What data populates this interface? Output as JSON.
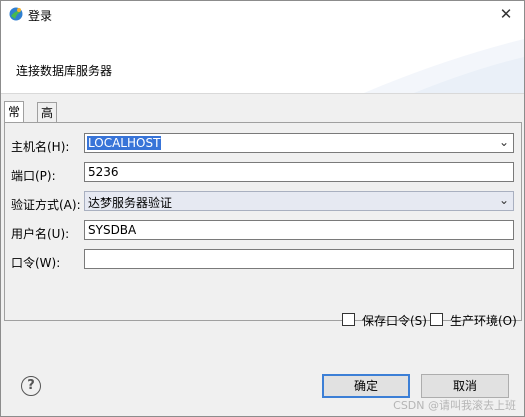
{
  "window": {
    "title": "登录",
    "close_symbol": "✕",
    "banner_text": "连接数据库服务器"
  },
  "tabs": [
    {
      "label": "常规",
      "active": true
    },
    {
      "label": "高级",
      "active": false
    }
  ],
  "form": {
    "host_label": "主机名(H):",
    "host_value": "LOCALHOST",
    "port_label": "端口(P):",
    "port_value": "5236",
    "auth_label": "验证方式(A):",
    "auth_value": "达梦服务器验证",
    "user_label": "用户名(U):",
    "user_value": "SYSDBA",
    "password_label": "口令(W):",
    "password_value": ""
  },
  "options": {
    "save_password_label": "保存口令(S)",
    "save_password_checked": false,
    "prod_env_label": "生产环境(O)",
    "prod_env_checked": false
  },
  "footer": {
    "help_symbol": "?",
    "ok_label": "确定",
    "cancel_label": "取消"
  },
  "watermark": "CSDN @请叫我滚去上班",
  "colors": {
    "selection": "#3874d8",
    "default_button_border": "#3c7fd6",
    "disabled_combo_bg": "#e6e9f2"
  },
  "icons": {
    "app": "dm-logo-icon",
    "close": "close-icon",
    "dropdown": "chevron-down-icon",
    "help": "help-icon"
  }
}
